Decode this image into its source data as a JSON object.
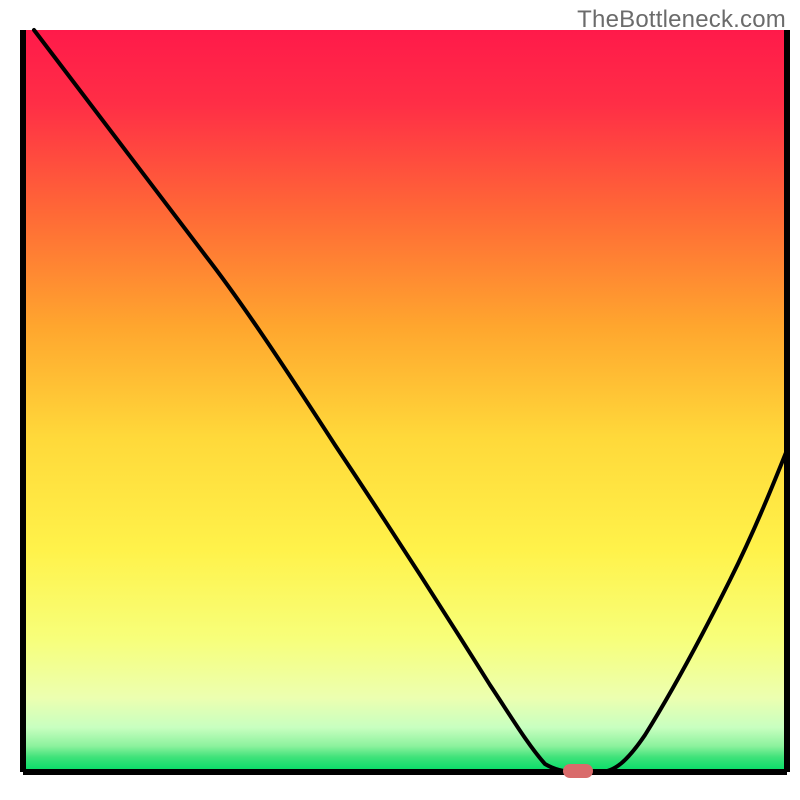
{
  "watermark": "TheBottleneck.com",
  "chart_data": {
    "type": "line",
    "title": "",
    "xlabel": "",
    "ylabel": "",
    "xlim": [
      0,
      100
    ],
    "ylim": [
      0,
      100
    ],
    "grid": false,
    "legend": false,
    "annotations": [],
    "series": [
      {
        "name": "bottleneck-curve",
        "x": [
          0,
          5,
          10,
          15,
          20,
          25,
          30,
          35,
          40,
          45,
          50,
          55,
          60,
          62,
          64,
          66,
          68,
          70,
          72,
          75,
          80,
          85,
          90,
          95,
          100
        ],
        "values": [
          100,
          93,
          86,
          80,
          74,
          69,
          63,
          56,
          49,
          42,
          35,
          27,
          18,
          13,
          8,
          4,
          1,
          0,
          0,
          1,
          5,
          11,
          19,
          28,
          38
        ]
      }
    ],
    "gradient_background": {
      "top_color": "#ff1a4a",
      "mid_color_high": "#ff7a2a",
      "mid_color": "#ffd93a",
      "mid_color_low": "#f7ff7a",
      "green_band_color": "#00dd66",
      "bottom_band_colors": [
        "#8cf29d",
        "#00dd66"
      ]
    },
    "marker": {
      "color": "#d96b6b",
      "x_percent": 70,
      "width_percent": 3.5
    },
    "axis_color": "#000000"
  }
}
